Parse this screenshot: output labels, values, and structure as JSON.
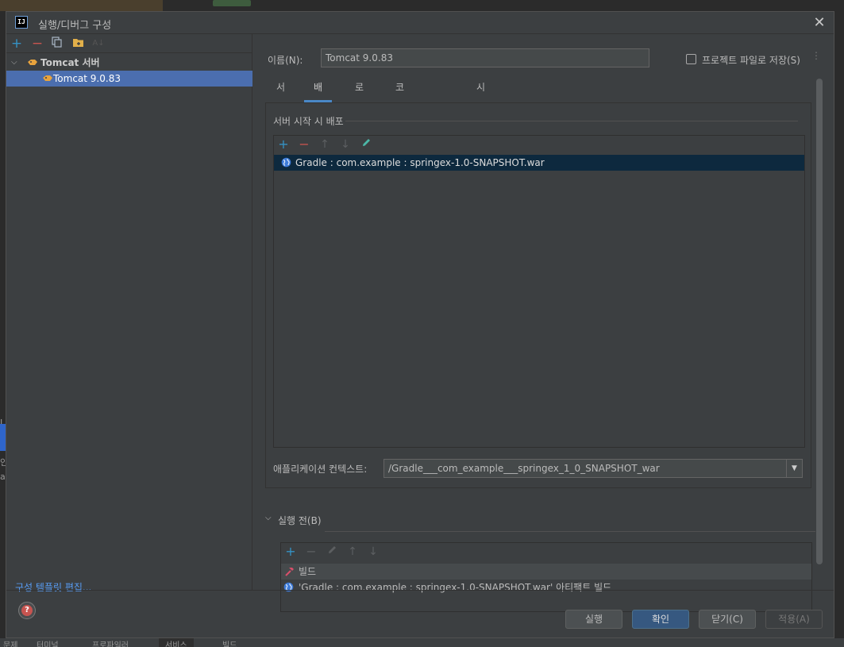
{
  "background": {
    "left_texts": [
      "I",
      "인",
      "at"
    ],
    "status_items": [
      "문제",
      "터미널",
      "프로파일러",
      "서비스",
      "빌드"
    ]
  },
  "dialog": {
    "title": "실행/디버그 구성",
    "app_icon_text": "IJ",
    "close_icon": "close-icon"
  },
  "left": {
    "toolbar": [
      {
        "name": "add-icon",
        "glyph": "+",
        "color": "#3592c4"
      },
      {
        "name": "remove-icon",
        "glyph": "−",
        "color": "#c75450"
      },
      {
        "name": "copy-icon",
        "glyph": "⧉",
        "color": "#a9b7c6"
      },
      {
        "name": "folder-icon",
        "glyph": "▰",
        "color": "#e2b04a"
      },
      {
        "name": "sort-icon",
        "glyph": "⇅",
        "color": "#666666"
      }
    ],
    "tree": {
      "group_label": "Tomcat 서버",
      "item_label": "Tomcat 9.0.83"
    },
    "templates_link": "구성 템플릿 편집..."
  },
  "right": {
    "name_label": "이름(N):",
    "name_value": "Tomcat 9.0.83",
    "save_to_project_label": "프로젝트 파일로 저장(S)",
    "save_to_project_checked": false,
    "tabs": [
      "서버",
      "배포",
      "로그",
      "코드 커버리지",
      "시작/연결"
    ],
    "active_tab": "배포",
    "deploy": {
      "section_title": "서버 시작 시 배포",
      "items": [
        "Gradle : com.example : springex-1.0-SNAPSHOT.war"
      ],
      "context_label": "애플리케이션 컨텍스트:",
      "context_value": "/Gradle___com_example___springex_1_0_SNAPSHOT_war"
    },
    "before_launch": {
      "label": "실행 전(B)",
      "items": [
        {
          "icon": "hammer-icon",
          "label": "빌드"
        },
        {
          "icon": "globe-icon",
          "label": "'Gradle : com.example : springex-1.0-SNAPSHOT.war' 아티팩트 빌드"
        }
      ]
    }
  },
  "footer": {
    "help_icon": "help-icon",
    "buttons": {
      "run": "실행",
      "ok": "확인",
      "close": "닫기(C)",
      "apply": "적용(A)"
    }
  },
  "colors": {
    "dialog_bg": "#3c3f41",
    "selection": "#4b6eaf",
    "list_selection": "#0d293e",
    "link": "#589df6",
    "tab_underline": "#4a88c7",
    "primary_button": "#365880"
  }
}
